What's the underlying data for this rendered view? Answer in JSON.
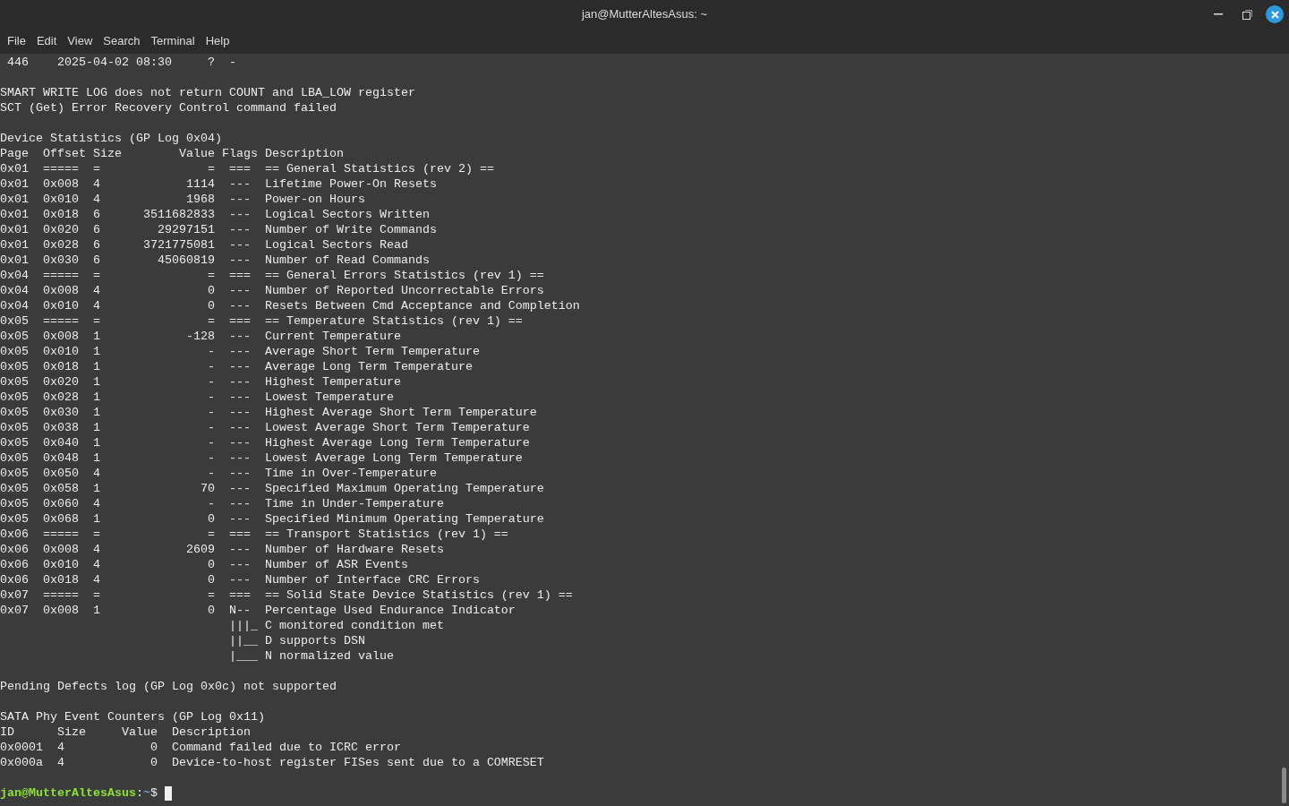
{
  "window": {
    "title": "jan@MutterAltesAsus: ~"
  },
  "menu": [
    "File",
    "Edit",
    "View",
    "Search",
    "Terminal",
    "Help"
  ],
  "lines": [
    {
      "kind": "text",
      "text": " 446    2025-04-02 08:30     ?  -"
    },
    {
      "kind": "blank"
    },
    {
      "kind": "text",
      "text": "SMART WRITE LOG does not return COUNT and LBA_LOW register"
    },
    {
      "kind": "text",
      "text": "SCT (Get) Error Recovery Control command failed"
    },
    {
      "kind": "blank"
    },
    {
      "kind": "text",
      "text": "Device Statistics (GP Log 0x04)"
    },
    {
      "kind": "text",
      "text": "Page  Offset Size        Value Flags Description"
    },
    {
      "kind": "text",
      "text": "0x01  =====  =               =  ===  == General Statistics (rev 2) =="
    },
    {
      "kind": "text",
      "text": "0x01  0x008  4            1114  ---  Lifetime Power-On Resets"
    },
    {
      "kind": "text",
      "text": "0x01  0x010  4            1968  ---  Power-on Hours"
    },
    {
      "kind": "text",
      "text": "0x01  0x018  6      3511682833  ---  Logical Sectors Written"
    },
    {
      "kind": "text",
      "text": "0x01  0x020  6        29297151  ---  Number of Write Commands"
    },
    {
      "kind": "text",
      "text": "0x01  0x028  6      3721775081  ---  Logical Sectors Read"
    },
    {
      "kind": "text",
      "text": "0x01  0x030  6        45060819  ---  Number of Read Commands"
    },
    {
      "kind": "text",
      "text": "0x04  =====  =               =  ===  == General Errors Statistics (rev 1) =="
    },
    {
      "kind": "text",
      "text": "0x04  0x008  4               0  ---  Number of Reported Uncorrectable Errors"
    },
    {
      "kind": "text",
      "text": "0x04  0x010  4               0  ---  Resets Between Cmd Acceptance and Completion"
    },
    {
      "kind": "text",
      "text": "0x05  =====  =               =  ===  == Temperature Statistics (rev 1) =="
    },
    {
      "kind": "text",
      "text": "0x05  0x008  1            -128  ---  Current Temperature"
    },
    {
      "kind": "text",
      "text": "0x05  0x010  1               -  ---  Average Short Term Temperature"
    },
    {
      "kind": "text",
      "text": "0x05  0x018  1               -  ---  Average Long Term Temperature"
    },
    {
      "kind": "text",
      "text": "0x05  0x020  1               -  ---  Highest Temperature"
    },
    {
      "kind": "text",
      "text": "0x05  0x028  1               -  ---  Lowest Temperature"
    },
    {
      "kind": "text",
      "text": "0x05  0x030  1               -  ---  Highest Average Short Term Temperature"
    },
    {
      "kind": "text",
      "text": "0x05  0x038  1               -  ---  Lowest Average Short Term Temperature"
    },
    {
      "kind": "text",
      "text": "0x05  0x040  1               -  ---  Highest Average Long Term Temperature"
    },
    {
      "kind": "text",
      "text": "0x05  0x048  1               -  ---  Lowest Average Long Term Temperature"
    },
    {
      "kind": "text",
      "text": "0x05  0x050  4               -  ---  Time in Over-Temperature"
    },
    {
      "kind": "text",
      "text": "0x05  0x058  1              70  ---  Specified Maximum Operating Temperature"
    },
    {
      "kind": "text",
      "text": "0x05  0x060  4               -  ---  Time in Under-Temperature"
    },
    {
      "kind": "text",
      "text": "0x05  0x068  1               0  ---  Specified Minimum Operating Temperature"
    },
    {
      "kind": "text",
      "text": "0x06  =====  =               =  ===  == Transport Statistics (rev 1) =="
    },
    {
      "kind": "text",
      "text": "0x06  0x008  4            2609  ---  Number of Hardware Resets"
    },
    {
      "kind": "text",
      "text": "0x06  0x010  4               0  ---  Number of ASR Events"
    },
    {
      "kind": "text",
      "text": "0x06  0x018  4               0  ---  Number of Interface CRC Errors"
    },
    {
      "kind": "text",
      "text": "0x07  =====  =               =  ===  == Solid State Device Statistics (rev 1) =="
    },
    {
      "kind": "text",
      "text": "0x07  0x008  1               0  N--  Percentage Used Endurance Indicator"
    },
    {
      "kind": "text",
      "text": "                                |||_ C monitored condition met"
    },
    {
      "kind": "text",
      "text": "                                ||__ D supports DSN"
    },
    {
      "kind": "text",
      "text": "                                |___ N normalized value"
    },
    {
      "kind": "blank"
    },
    {
      "kind": "text",
      "text": "Pending Defects log (GP Log 0x0c) not supported"
    },
    {
      "kind": "blank"
    },
    {
      "kind": "text",
      "text": "SATA Phy Event Counters (GP Log 0x11)"
    },
    {
      "kind": "text",
      "text": "ID      Size     Value  Description"
    },
    {
      "kind": "text",
      "text": "0x0001  4            0  Command failed due to ICRC error"
    },
    {
      "kind": "text",
      "text": "0x000a  4            0  Device-to-host register FISes sent due to a COMRESET"
    },
    {
      "kind": "blank"
    }
  ],
  "prompt": {
    "user": "jan@MutterAltesAsus",
    "separator": ":",
    "path": "~",
    "symbol": "$"
  }
}
